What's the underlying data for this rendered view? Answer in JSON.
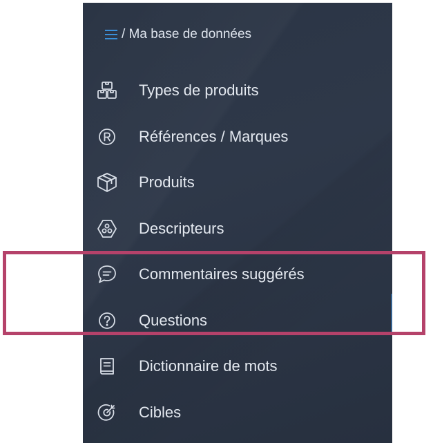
{
  "header": {
    "breadcrumb": "/ Ma base de données",
    "menu_icon": "hamburger-menu-icon"
  },
  "nav": {
    "items": [
      {
        "label": "Types de produits",
        "icon": "boxes-icon"
      },
      {
        "label": "Références / Marques",
        "icon": "registered-icon"
      },
      {
        "label": "Produits",
        "icon": "cube-icon"
      },
      {
        "label": "Descripteurs",
        "icon": "descriptor-hexagon-icon"
      },
      {
        "label": "Commentaires suggérés",
        "icon": "chat-bubble-icon"
      },
      {
        "label": "Questions",
        "icon": "question-circle-icon"
      },
      {
        "label": "Dictionnaire de mots",
        "icon": "book-icon"
      },
      {
        "label": "Cibles",
        "icon": "target-icon"
      }
    ]
  },
  "colors": {
    "sidebar_bg": "#2b3545",
    "text": "#e4e9f0",
    "menu_icon": "#3a8fd9",
    "highlight_border": "#b5426a"
  }
}
